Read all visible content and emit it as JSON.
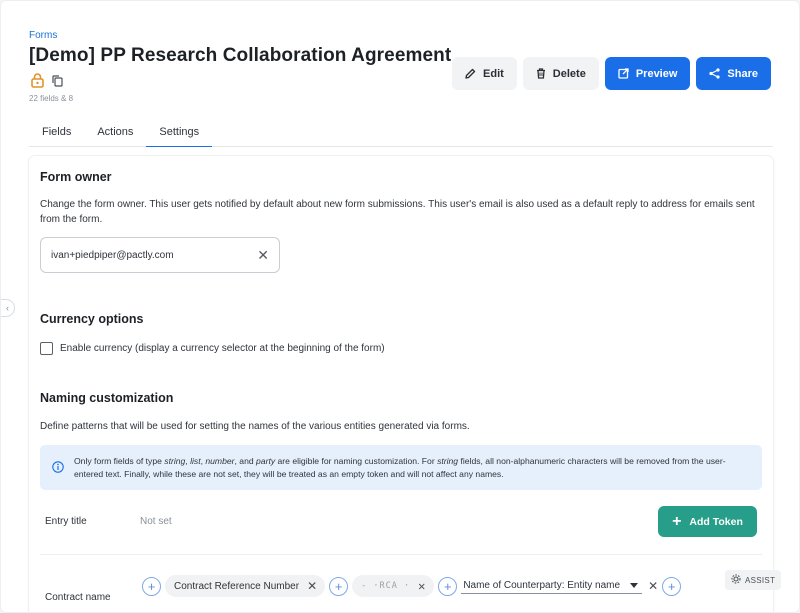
{
  "header": {
    "breadcrumb": "Forms",
    "title": "[Demo] PP Research Collaboration Agreement",
    "meta": "22 fields & 8",
    "icons": [
      "lock-icon",
      "copy-icon"
    ],
    "lock_color": "#e0922a"
  },
  "actions": {
    "edit_label": "Edit",
    "delete_label": "Delete",
    "preview_label": "Preview",
    "share_label": "Share",
    "primary_color": "#1a6fe8"
  },
  "tabs": [
    {
      "label": "Fields",
      "active": false
    },
    {
      "label": "Actions",
      "active": false
    },
    {
      "label": "Settings",
      "active": true
    }
  ],
  "form_owner": {
    "title": "Form owner",
    "description": "Change the form owner. This user gets notified by default about new form submissions. This user's email is also used as a default reply to address for emails sent from the form.",
    "value": "ivan+piedpiper@pactly.com"
  },
  "currency": {
    "title": "Currency options",
    "checkbox_label": "Enable currency (display a currency selector at the beginning of the form)",
    "checked": false
  },
  "naming": {
    "title": "Naming customization",
    "description": "Define patterns that will be used for setting the names of the various entities generated via forms.",
    "info_parts": {
      "p1": "Only form fields of type ",
      "t1": "string",
      "p2": ", ",
      "t2": "list",
      "p3": ", ",
      "t3": "number",
      "p4": ", and ",
      "t4": "party",
      "p5": " are eligible for naming customization. For ",
      "t5": "string",
      "p6": " fields, all non-alphanumeric characters will be removed from the user-entered text. Finally, while these are not set, they will be treated as an empty token and will not affect any names."
    },
    "entry_title": {
      "label": "Entry title",
      "value": "Not set",
      "add_token_label": "Add Token",
      "accent": "#279e8a"
    },
    "contract_name": {
      "label": "Contract name",
      "tokens": [
        {
          "type": "field",
          "label": "Contract Reference Number"
        },
        {
          "type": "separator",
          "label": "- ·RCA ·"
        },
        {
          "type": "select",
          "label": "Name of Counterparty: Entity name"
        }
      ],
      "assist_label": "ASSIST"
    }
  }
}
